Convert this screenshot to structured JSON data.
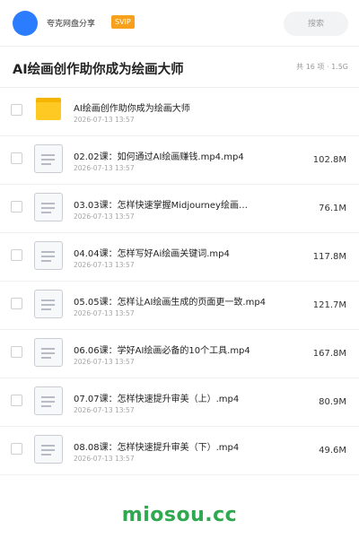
{
  "header": {
    "user_name": "夸克网盘分享",
    "badge": "SVIP",
    "search_placeholder": "搜索"
  },
  "folder": {
    "title": "AI绘画创作助你成为绘画大师",
    "meta": "共 16 项 · 1.5G"
  },
  "files": [
    {
      "type": "folder",
      "icon": "folder-icon",
      "name": "AI绘画创作助你成为绘画大师",
      "date": "2026-07-13 13:57",
      "size": ""
    },
    {
      "type": "file",
      "icon": "document-icon",
      "name": "02.02课：如何通过AI绘画赚钱.mp4.mp4",
      "date": "2026-07-13 13:57",
      "size": "102.8M"
    },
    {
      "type": "file",
      "icon": "document-icon",
      "name": "03.03课：怎样快速掌握Midjourney绘画…",
      "date": "2026-07-13 13:57",
      "size": "76.1M"
    },
    {
      "type": "file",
      "icon": "document-icon",
      "name": "04.04课：怎样写好Ai绘画关键词.mp4",
      "date": "2026-07-13 13:57",
      "size": "117.8M"
    },
    {
      "type": "file",
      "icon": "document-icon",
      "name": "05.05课：怎样让AI绘画生成的页面更一致.mp4",
      "date": "2026-07-13 13:57",
      "size": "121.7M"
    },
    {
      "type": "file",
      "icon": "document-icon",
      "name": "06.06课：学好AI绘画必备的10个工具.mp4",
      "date": "2026-07-13 13:57",
      "size": "167.8M"
    },
    {
      "type": "file",
      "icon": "document-icon",
      "name": "07.07课：怎样快速提升审美（上）.mp4",
      "date": "2026-07-13 13:57",
      "size": "80.9M"
    },
    {
      "type": "file",
      "icon": "document-icon",
      "name": "08.08课：怎样快速提升审美（下）.mp4",
      "date": "2026-07-13 13:57",
      "size": "49.6M"
    }
  ],
  "watermark": "miosou.cc",
  "colors": {
    "avatar": "#2b7cff",
    "svip_badge": "#f7a01c",
    "folder": "#ffc924",
    "watermark": "#2fa84f"
  }
}
